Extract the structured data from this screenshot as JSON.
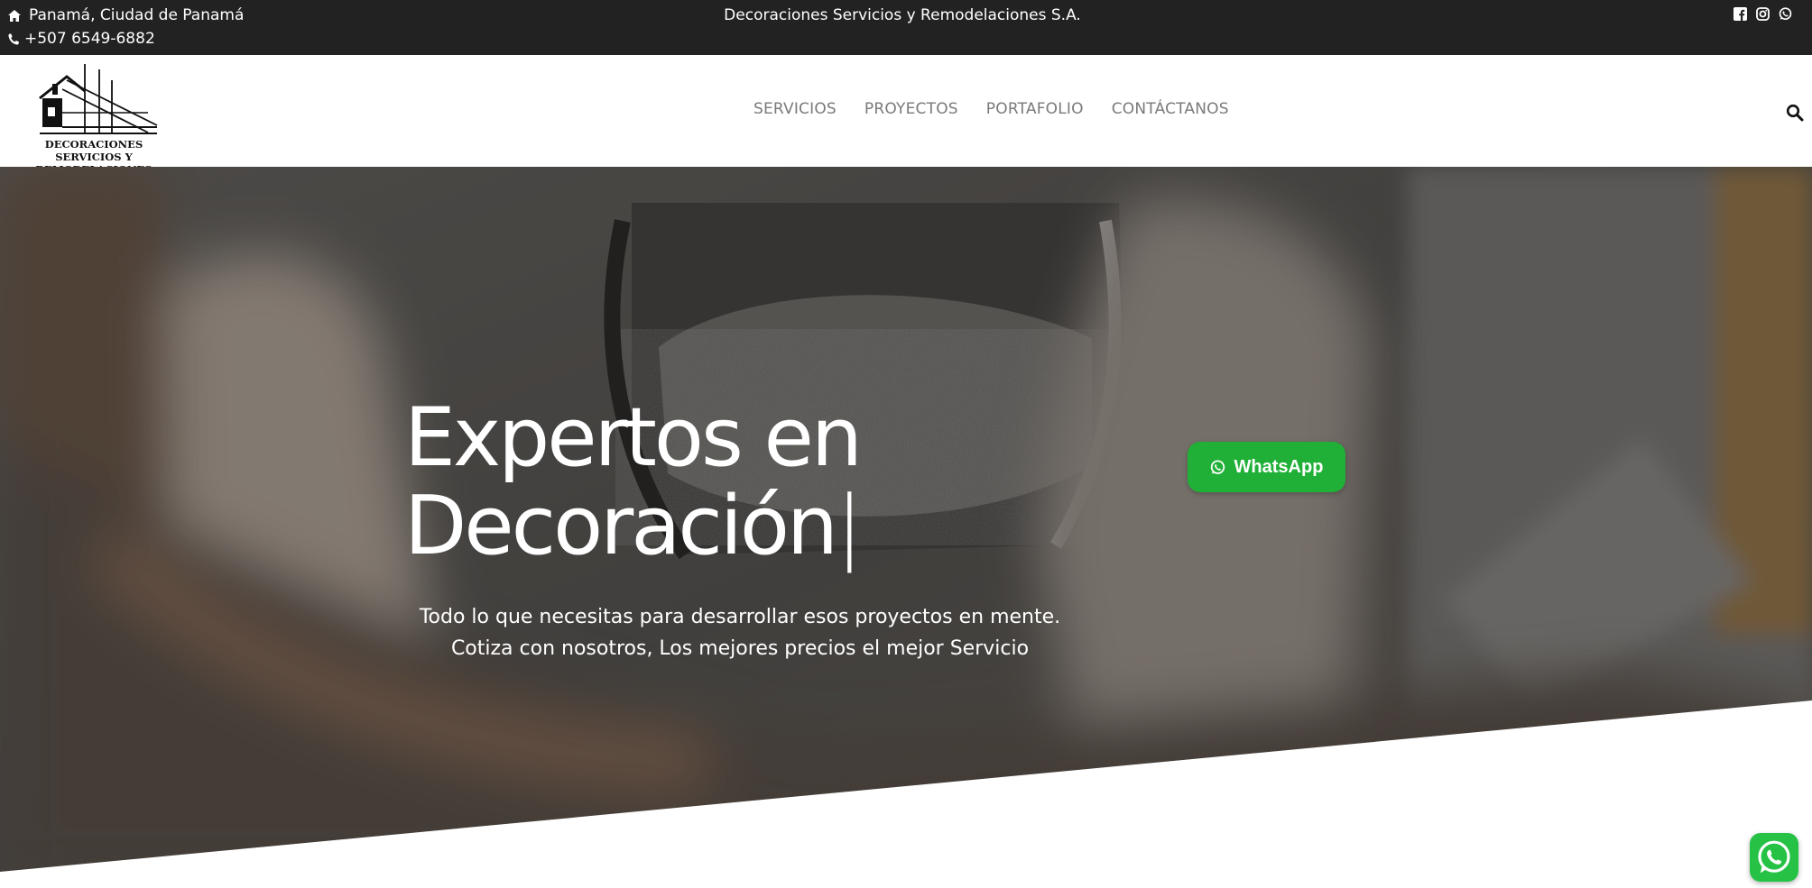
{
  "topbar": {
    "location": "Panamá, Ciudad de Panamá",
    "phone": "+507 6549-6882",
    "company": "Decoraciones Servicios y Remodelaciones S.A.",
    "social_icons": [
      "facebook-icon",
      "instagram-icon",
      "whatsapp-icon"
    ]
  },
  "header": {
    "logo_text": "DECORACIONES SERVICIOS Y REMODELACIONES",
    "nav": [
      {
        "label": "SERVICIOS"
      },
      {
        "label": "PROYECTOS"
      },
      {
        "label": "PORTAFOLIO"
      },
      {
        "label": "CONTÁCTANOS"
      }
    ]
  },
  "hero": {
    "title_line1": "Expertos en",
    "title_line2": "Decoración",
    "cursor": "|",
    "subtitle_line1": "Todo lo que necesitas para desarrollar esos proyectos en mente.",
    "subtitle_line2": "Cotiza con nosotros, Los mejores precios el mejor Servicio",
    "whatsapp_label": "WhatsApp"
  },
  "colors": {
    "topbar_bg": "#222222",
    "whatsapp_green": "#20b038",
    "nav_text": "#7a7a7a"
  }
}
